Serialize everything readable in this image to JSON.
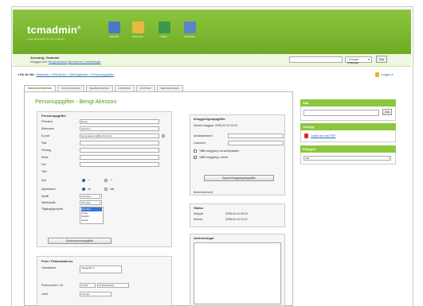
{
  "header": {
    "logo": "tcmadmin",
    "tagline": "a web application for your business",
    "icons": [
      {
        "name": "home-icon",
        "label": "Startsida",
        "color": "#4a78c8"
      },
      {
        "name": "folder-icon",
        "label": "Dokument",
        "color": "#e8b840"
      },
      {
        "name": "image-icon",
        "label": "Bilder",
        "color": "#3a9a4a"
      },
      {
        "name": "users-icon",
        "label": "Användare",
        "color": "#5a86c8"
      }
    ],
    "language_select": "- Choose language -",
    "go_button": "Sök"
  },
  "userbar": {
    "account": "Ansvarig: Owander",
    "links_prefix": "Inloggad som:",
    "user_link": "Bengt Akesson",
    "logout_link": "Byt lösenord | Inställningar"
  },
  "breadcrumb": {
    "label": "Du är här:",
    "path": "Startsida > Mitt konto > Behörigheter > Personuppgifter"
  },
  "logout": "Logga ut",
  "tabs": [
    {
      "label": "PERSONUPPGIFTER",
      "active": true
    },
    {
      "label": "INSTÄLLNINGAR",
      "active": false
    },
    {
      "label": "BEHÖRIGHETER",
      "active": false
    },
    {
      "label": "GRUPPER",
      "active": false
    },
    {
      "label": "HISTORIK",
      "active": false
    },
    {
      "label": "MEDDELANDEN",
      "active": false
    }
  ],
  "page_title": "Personuppgifter - Bengt Akesson",
  "personal": {
    "title": "Personuppgifter",
    "fields": [
      {
        "label": "Förnamn",
        "value": "Bengt"
      },
      {
        "label": "Efternamn",
        "value": "Akesson"
      },
      {
        "label": "E-post",
        "value": "bengt.akesson@hotmail.com"
      },
      {
        "label": "Tele",
        "value": ""
      },
      {
        "label": "Företag",
        "value": ""
      },
      {
        "label": "Mobil",
        "value": ""
      },
      {
        "label": "Fax",
        "value": ""
      },
      {
        "label": "Titel",
        "value": ""
      }
    ],
    "gender_label": "Kön",
    "newsletter_label": "Nyhetsbrev",
    "newsletter_yes": "Ja",
    "newsletter_no": "Nej",
    "lang_label": "Språk",
    "lang_value": "Svenska",
    "web_lang_label": "Webbspråk",
    "web_lang_value": "Svenska",
    "accessible_label": "Tillgängliga språk",
    "accessible_options": [
      "Svenska",
      "Norsk",
      "English",
      "Dansk"
    ],
    "save_button": "Spara personuppgifter"
  },
  "address": {
    "title": "Post / Fakturaadress",
    "street_label": "Gatuadress",
    "street_value": "Vasagatan 5",
    "zip_label": "Postnummer / ort",
    "zip_value": "10130",
    "city_value": "STOCKHOLM",
    "country_label": "Land",
    "country_value": "Sverige"
  },
  "login": {
    "title": "Inloggningsuppgifter",
    "last_login": "Senast inloggad: 2008-04-10 09:15",
    "username_label": "Användarnamn",
    "password_label": "Lösenord",
    "check1": "Tillåt inloggning via webbplatsen",
    "check2": "Tillåt inloggning i admin",
    "save_button": "Spara inloggningsuppgifter",
    "change_pw": "Ändra lösenord"
  },
  "status": {
    "title": "Status",
    "created_label": "Skapad",
    "created_value": "2008-04-10 09:15",
    "changed_label": "Ändrad",
    "changed_value": "2008-04-15 10:22"
  },
  "notes": {
    "title": "Anteckningar"
  },
  "sidebar": {
    "search_title": "Sök",
    "search_button": "Sök",
    "tools_title": "Verktyg",
    "pdf_link": "Ladda ner som PDF",
    "category_title": "Kategori",
    "category_value": "Alla"
  }
}
